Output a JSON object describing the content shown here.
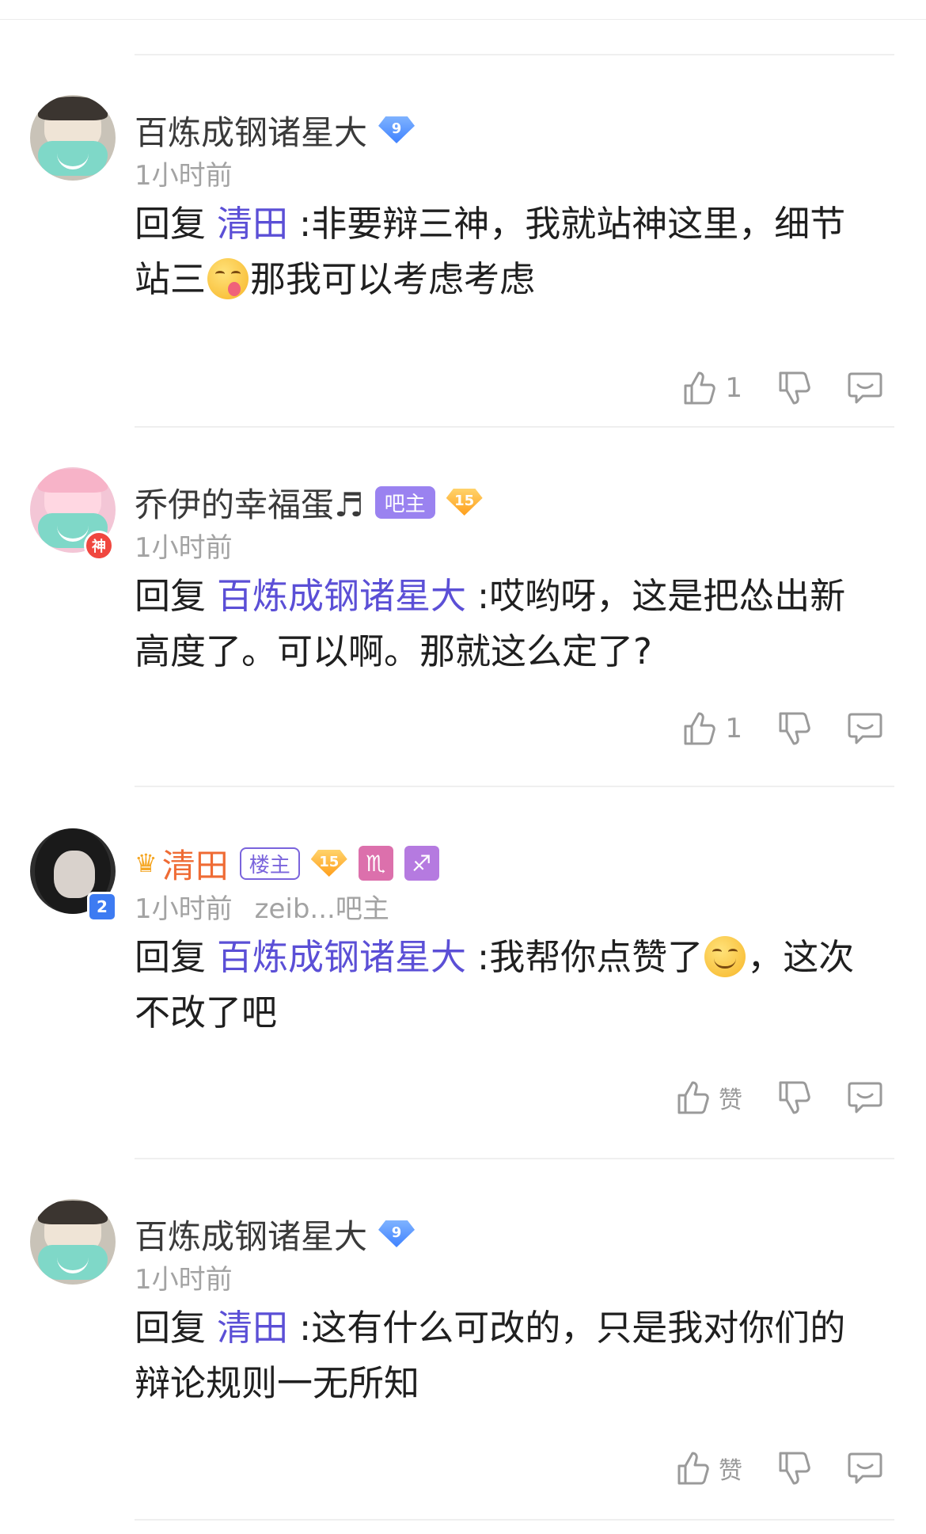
{
  "comments": [
    {
      "name": "百炼成钢诸星大",
      "level": "9",
      "time": "1小时前",
      "reply_prefix": "回复",
      "reply_to": "清田",
      "text_part1": ":非要辩三神，我就站神这里，细节站三",
      "text_part2": "那我可以考虑考虑",
      "like_count": "1"
    },
    {
      "name": "乔伊的幸福蛋♬",
      "avatar_badge": "神",
      "tag": "吧主",
      "level": "15",
      "time": "1小时前",
      "reply_prefix": "回复",
      "reply_to": "百炼成钢诸星大",
      "text_part1": ":哎哟呀，这是把怂出新高度了。可以啊。那就这么定了?",
      "like_count": "1"
    },
    {
      "name": "清田",
      "avatar_badge": "2",
      "tag": "楼主",
      "level": "15",
      "zodiac1": "♏",
      "zodiac2": "♐",
      "time": "1小时前",
      "source": "zeib...吧主",
      "reply_prefix": "回复",
      "reply_to": "百炼成钢诸星大",
      "text_part1": ":我帮你点赞了",
      "text_part2": "，这次不改了吧",
      "like_count": "赞"
    },
    {
      "name": "百炼成钢诸星大",
      "level": "9",
      "time": "1小时前",
      "reply_prefix": "回复",
      "reply_to": "清田",
      "text_part1": ":这有什么可改的，只是我对你们的辩论规则一无所知",
      "like_count": "赞"
    }
  ],
  "icons": {
    "like": "thumbs-up-icon",
    "dislike": "thumbs-down-icon",
    "reply": "comment-bubble-icon"
  }
}
